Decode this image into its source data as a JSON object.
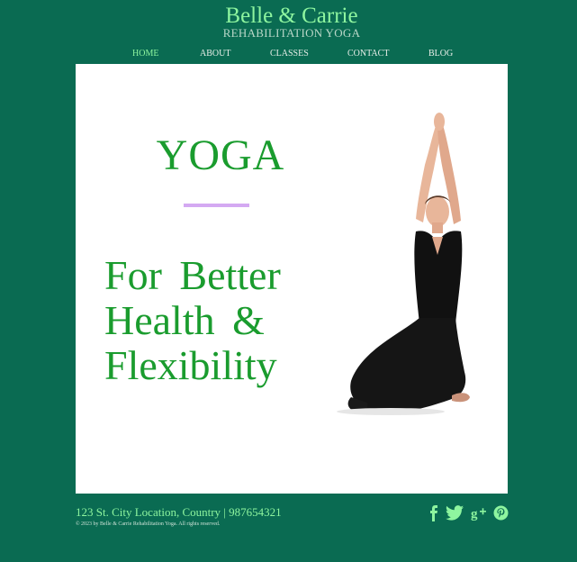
{
  "header": {
    "brand_title": "Belle & Carrie",
    "brand_subtitle": "REHABILITATION YOGA"
  },
  "nav": {
    "items": [
      {
        "label": "HOME",
        "active": true
      },
      {
        "label": "ABOUT",
        "active": false
      },
      {
        "label": "CLASSES",
        "active": false
      },
      {
        "label": "CONTACT",
        "active": false
      },
      {
        "label": "BLOG",
        "active": false
      }
    ]
  },
  "hero": {
    "title": "YOGA",
    "tagline_lines": [
      "For Better",
      "Health &",
      "Flexibility"
    ],
    "image_icon": "yoga-woman-image"
  },
  "footer": {
    "address": "123 St. City Location, Country | 987654321",
    "copyright": "© 2023 by Belle & Carrie Rehabilitation Yoga. All rights reserved.",
    "social": [
      "facebook-icon",
      "twitter-icon",
      "google-plus-icon",
      "pinterest-icon"
    ]
  },
  "colors": {
    "background": "#0a6b52",
    "accent_green": "#8ef59f",
    "hero_text": "#1a9c2e",
    "divider": "#d4a9f2",
    "panel": "#ffffff"
  }
}
